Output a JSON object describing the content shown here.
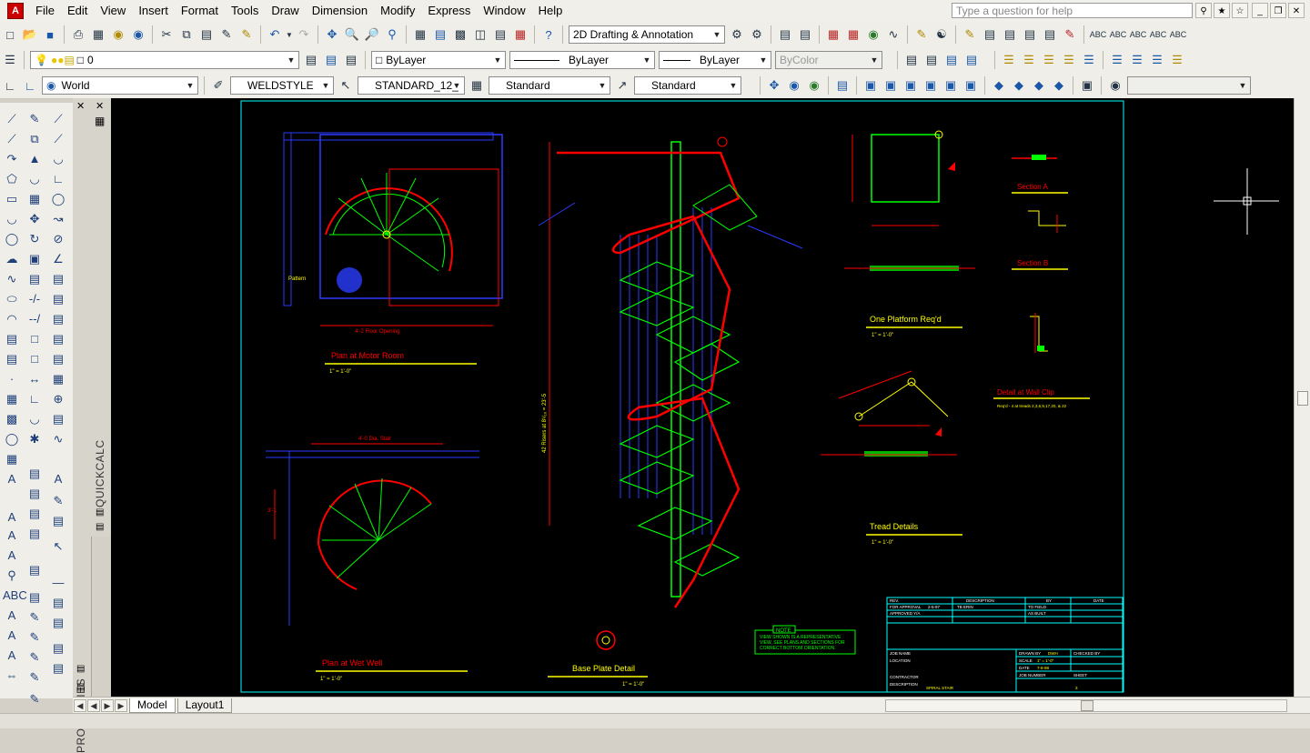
{
  "menu": {
    "items": [
      "File",
      "Edit",
      "View",
      "Insert",
      "Format",
      "Tools",
      "Draw",
      "Dimension",
      "Modify",
      "Express",
      "Window",
      "Help"
    ],
    "help_placeholder": "Type a question for help"
  },
  "toolbar1": {
    "workspace": "2D Drafting & Annotation"
  },
  "toolbar2": {
    "layer": "0",
    "color": "ByLayer",
    "linetype": "ByLayer",
    "lineweight": "ByLayer",
    "plotstyle": "ByColor"
  },
  "toolbar3": {
    "ucs": "World",
    "dimstyle": "WELDSTYLE",
    "textstyle": "STANDARD_12_",
    "tablestyle": "Standard",
    "mleaderstyle": "Standard"
  },
  "palettes": {
    "quickcalc": "QUICKCALC",
    "properties": "PROPERTIES"
  },
  "layout_tabs": [
    "Model",
    "Layout1"
  ],
  "drawing": {
    "views": {
      "motor_room": {
        "title": "Plan at Motor Room",
        "scale": "1\" = 1'-0\"",
        "floor_opening": "4'-2 Floor Opening",
        "floor_opening_v": "4'-2 Floor Opening",
        "label_pattern": "Pattern"
      },
      "wet_well": {
        "title": "Plan at Wet Well",
        "scale": "1\" = 1'-0\"",
        "dia": "4'-0 Dia. Stair",
        "dim": "3'-1"
      },
      "base_plate": {
        "title": "Base Plate Detail",
        "scale": "1\" = 1'-0\""
      },
      "platform": {
        "title": "One Platform Req'd",
        "scale": "1\" = 1'-0\""
      },
      "tread": {
        "title": "Tread Details",
        "scale": "1\" = 1'-0\""
      },
      "section_a": {
        "title": "Section A"
      },
      "section_b": {
        "title": "Section B"
      },
      "wall_clip": {
        "title": "Detail at Wall Clip",
        "note": "Req'd - 4 at treads 2,3,6,9,17,20, & 22"
      },
      "elevation": {
        "vertical_dim": "42 Risers at 8¹/₁₆ = 23'-5"
      }
    },
    "note": {
      "title": "NOTE",
      "lines": [
        "VIEW SHOWN IS A REPRESENTATIVE",
        "VIEW, SEE PLANS AND SECTIONS FOR",
        "CORRECT BOTTOM ORIENTATION."
      ]
    },
    "title_block": {
      "headers": [
        "REV.",
        "DESCRIPTION",
        "BY",
        "DATE"
      ],
      "rows": [
        [
          "FOR APPROVAL",
          "2-5-97",
          "TB ERIN",
          "TO FIELD"
        ],
        [
          "APPROVED Y/A",
          "",
          "",
          "AS BUILT"
        ]
      ],
      "job_name": "JOB NAME",
      "location": "LOCATION",
      "contractor": "CONTRACTOR",
      "description": "DESCRIPTION",
      "description_value": "SPIRAL STAIR",
      "drawn_by": "DRAWN BY",
      "drawn_by_value": "DWH",
      "checked_by": "CHECKED BY",
      "scale": "SCALE",
      "scale_value": "1\" = 1'-0\"",
      "date": "DATE",
      "date_value": "7-8-98",
      "job_number": "JOB NUMBER",
      "sheet": "SHEET",
      "sheet_value": "3"
    }
  },
  "colors": {
    "canvas": "#000000",
    "cyan": "#00ffff",
    "red": "#ff0000",
    "green": "#00ff00",
    "blue": "#2a3cff",
    "yellow": "#ffff00",
    "white": "#ffffff"
  }
}
